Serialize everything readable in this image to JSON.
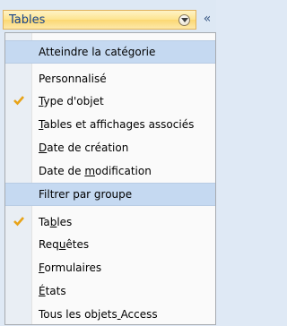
{
  "header": {
    "title": "Tables",
    "collapse_glyph": "«"
  },
  "menu": {
    "section_category": "Atteindre la catégorie",
    "category_items": [
      {
        "label": "Personnalisé",
        "checked": false
      },
      {
        "label": "Type d'objet",
        "checked": true
      },
      {
        "label": "Tables et affichages associés",
        "checked": false
      },
      {
        "label": "Date de création",
        "checked": false
      },
      {
        "label": "Date de modification",
        "checked": false
      }
    ],
    "section_filter": "Filtrer par groupe",
    "filter_items": [
      {
        "label": "Tables",
        "checked": true
      },
      {
        "label": "Requêtes",
        "checked": false
      },
      {
        "label": "Formulaires",
        "checked": false
      },
      {
        "label": "États",
        "checked": false
      },
      {
        "label": "Tous les objets Access",
        "checked": false
      }
    ]
  },
  "colors": {
    "check": "#e8a317",
    "section_bg": "#c5d9f1",
    "combo_border": "#e0b25d"
  }
}
